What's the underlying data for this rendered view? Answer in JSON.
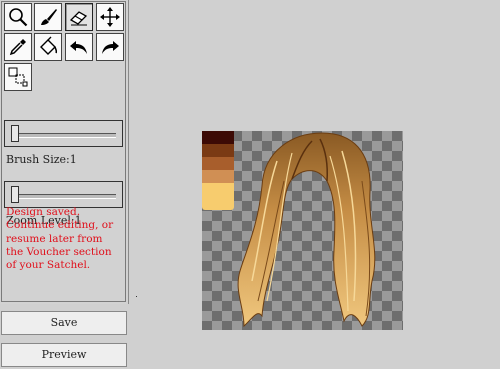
{
  "toolbar": {
    "tools": [
      {
        "id": "zoom",
        "icon": "magnifier-icon"
      },
      {
        "id": "brush",
        "icon": "brush-icon"
      },
      {
        "id": "eraser",
        "icon": "eraser-icon",
        "active": true
      },
      {
        "id": "move",
        "icon": "move-arrows-icon"
      },
      {
        "id": "eyedropper",
        "icon": "eyedropper-icon"
      },
      {
        "id": "fill",
        "icon": "paint-bucket-icon"
      },
      {
        "id": "undo",
        "icon": "undo-arrow-icon"
      },
      {
        "id": "redo",
        "icon": "redo-arrow-icon"
      },
      {
        "id": "select",
        "icon": "selection-icon"
      }
    ]
  },
  "brush_size": {
    "label": "Brush Size:1",
    "value": 1
  },
  "zoom": {
    "label": "Zoom Level:1",
    "value": 1
  },
  "message": {
    "line1": "Design saved.",
    "line2": "Continue editing, or",
    "line3": "resume later from",
    "line4": "the Voucher section",
    "line5": "of your Satchel."
  },
  "buttons": {
    "save": "Save",
    "preview": "Preview"
  },
  "palette": [
    "#3c0a05",
    "#7a3a14",
    "#a85e2c",
    "#d08f54",
    "#f7cc6e"
  ],
  "colors": {
    "message": "#e0101c",
    "background": "#d0d0d0"
  }
}
